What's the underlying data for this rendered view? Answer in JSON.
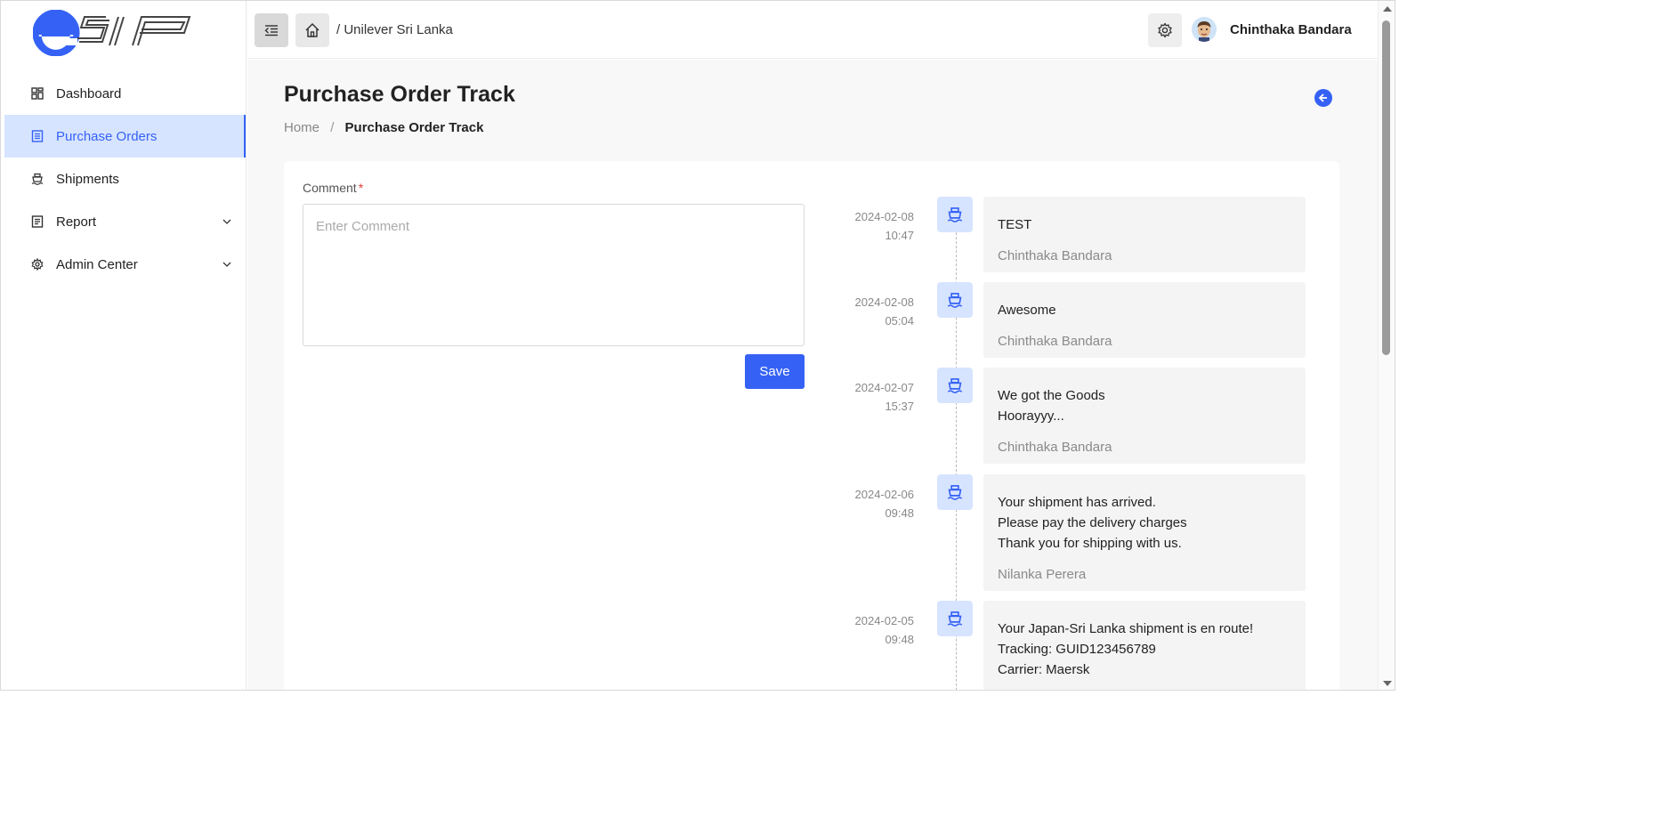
{
  "app": {
    "brand": "eSIP",
    "accent_color": "#3562f5",
    "accent_light": "#d7e4ff"
  },
  "sidebar": {
    "items": [
      {
        "label": "Dashboard",
        "icon": "dashboard-icon",
        "active": false,
        "expandable": false
      },
      {
        "label": "Purchase Orders",
        "icon": "document-icon",
        "active": true,
        "expandable": false
      },
      {
        "label": "Shipments",
        "icon": "ship-icon",
        "active": false,
        "expandable": false
      },
      {
        "label": "Report",
        "icon": "report-icon",
        "active": false,
        "expandable": true
      },
      {
        "label": "Admin Center",
        "icon": "gear-icon",
        "active": false,
        "expandable": true
      }
    ]
  },
  "topbar": {
    "organization": "/ Unilever Sri Lanka",
    "user_name": "Chinthaka Bandara",
    "menu_icon": "menu-fold-icon",
    "home_icon": "home-icon",
    "settings_icon": "gear-icon"
  },
  "page": {
    "title": "Purchase Order Track",
    "breadcrumb": {
      "home": "Home",
      "separator": "/",
      "current": "Purchase Order Track"
    }
  },
  "comment_form": {
    "label": "Comment",
    "required_mark": "*",
    "placeholder": "Enter Comment",
    "value": "",
    "save_label": "Save"
  },
  "timeline": [
    {
      "date": "2024-02-08",
      "time": "10:47",
      "message": "TEST",
      "author": "Chinthaka Bandara"
    },
    {
      "date": "2024-02-08",
      "time": "05:04",
      "message": "Awesome",
      "author": "Chinthaka Bandara"
    },
    {
      "date": "2024-02-07",
      "time": "15:37",
      "message": "We got the Goods\nHoorayyy...",
      "author": "Chinthaka Bandara"
    },
    {
      "date": "2024-02-06",
      "time": "09:48",
      "message": "Your shipment has arrived.\nPlease pay the delivery charges\nThank you for shipping with us.",
      "author": "Nilanka Perera"
    },
    {
      "date": "2024-02-05",
      "time": "09:48",
      "message": "Your Japan-Sri Lanka shipment is en route!\nTracking: GUID123456789\nCarrier: Maersk",
      "author": ""
    }
  ]
}
